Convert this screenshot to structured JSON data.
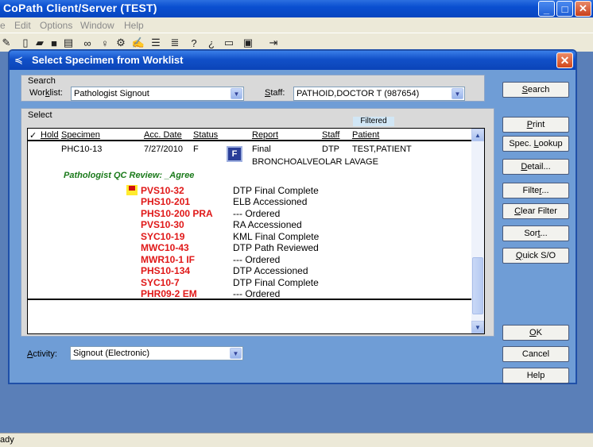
{
  "app": {
    "title": "CoPath Client/Server (TEST)",
    "minimize": "_",
    "maximize": "□",
    "close": "✕",
    "menu": [
      "e",
      "Edit",
      "Options",
      "Window",
      "Help"
    ],
    "status": "ady"
  },
  "toolbar_icons": [
    "open-icon",
    "new-icon",
    "folder-icon",
    "save-icon",
    "print-icon",
    "binoculars-icon",
    "users-icon",
    "tools-icon",
    "edit-icon",
    "list-icon",
    "help-icon",
    "context-help-icon",
    "document-icon",
    "bookmark-icon",
    "exit-icon"
  ],
  "dialog": {
    "title": "Select Specimen from Worklist",
    "close": "✕",
    "search_group_label": "Search",
    "worklist_label_pre": "Wor",
    "worklist_label_ul": "k",
    "worklist_label_post": "list:",
    "worklist_value": "Pathologist Signout",
    "staff_label_pre": "",
    "staff_label_ul": "S",
    "staff_label_post": "taff:",
    "staff_value": "PATHOID,DOCTOR T (987654)",
    "select_group_label": "Select",
    "filtered_tag": "Filtered",
    "columns": {
      "check": "✓",
      "hold": "Hold",
      "specimen": "Specimen",
      "acc_date": "Acc. Date",
      "status": "Status",
      "report": "Report",
      "staff": "Staff",
      "patient": "Patient"
    },
    "main_row": {
      "specimen": "PHC10-13",
      "acc_date": "7/27/2010",
      "status": "F",
      "report_icon": "F",
      "report": "Final",
      "staff": "DTP",
      "patient": "TEST,PATIENT",
      "description": "BRONCHOALVEOLAR LAVAGE"
    },
    "qc_review": "Pathologist QC Review:  _Agree",
    "sub_rows": [
      {
        "acc": "PVS10-32",
        "status": "DTP  Final Complete",
        "flag": true
      },
      {
        "acc": "PHS10-201",
        "status": "ELB  Accessioned"
      },
      {
        "acc": "PHS10-200 PRA",
        "status": "---  Ordered"
      },
      {
        "acc": "PVS10-30",
        "status": "RA   Accessioned"
      },
      {
        "acc": "SYC10-19",
        "status": "KML  Final Complete"
      },
      {
        "acc": "MWC10-43",
        "status": "DTP  Path Reviewed"
      },
      {
        "acc": "MWR10-1 IF",
        "status": "---  Ordered"
      },
      {
        "acc": "PHS10-134",
        "status": "DTP  Accessioned"
      },
      {
        "acc": "SYC10-7",
        "status": "DTP  Final Complete"
      },
      {
        "acc": "PHR09-2 EM",
        "status": "---  Ordered"
      }
    ],
    "activity_label_pre": "",
    "activity_label_ul": "A",
    "activity_label_post": "ctivity:",
    "activity_value": "Signout (Electronic)",
    "buttons": {
      "search": {
        "pre": "",
        "ul": "S",
        "post": "earch"
      },
      "print": {
        "pre": "",
        "ul": "P",
        "post": "rint"
      },
      "spec_lookup": {
        "pre": "Spec. ",
        "ul": "L",
        "post": "ookup"
      },
      "detail": {
        "pre": "",
        "ul": "D",
        "post": "etail..."
      },
      "filter": {
        "pre": "Filte",
        "ul": "r",
        "post": "..."
      },
      "clear_filter": {
        "pre": "",
        "ul": "C",
        "post": "lear Filter"
      },
      "sort": {
        "pre": "Sor",
        "ul": "t",
        "post": "..."
      },
      "quick_so": {
        "pre": "",
        "ul": "Q",
        "post": "uick S/O"
      },
      "ok": {
        "pre": "",
        "ul": "O",
        "post": "K"
      },
      "cancel": {
        "pre": "",
        "ul": "",
        "post": "Cancel"
      },
      "help": {
        "pre": "",
        "ul": "",
        "post": "Help"
      }
    }
  }
}
